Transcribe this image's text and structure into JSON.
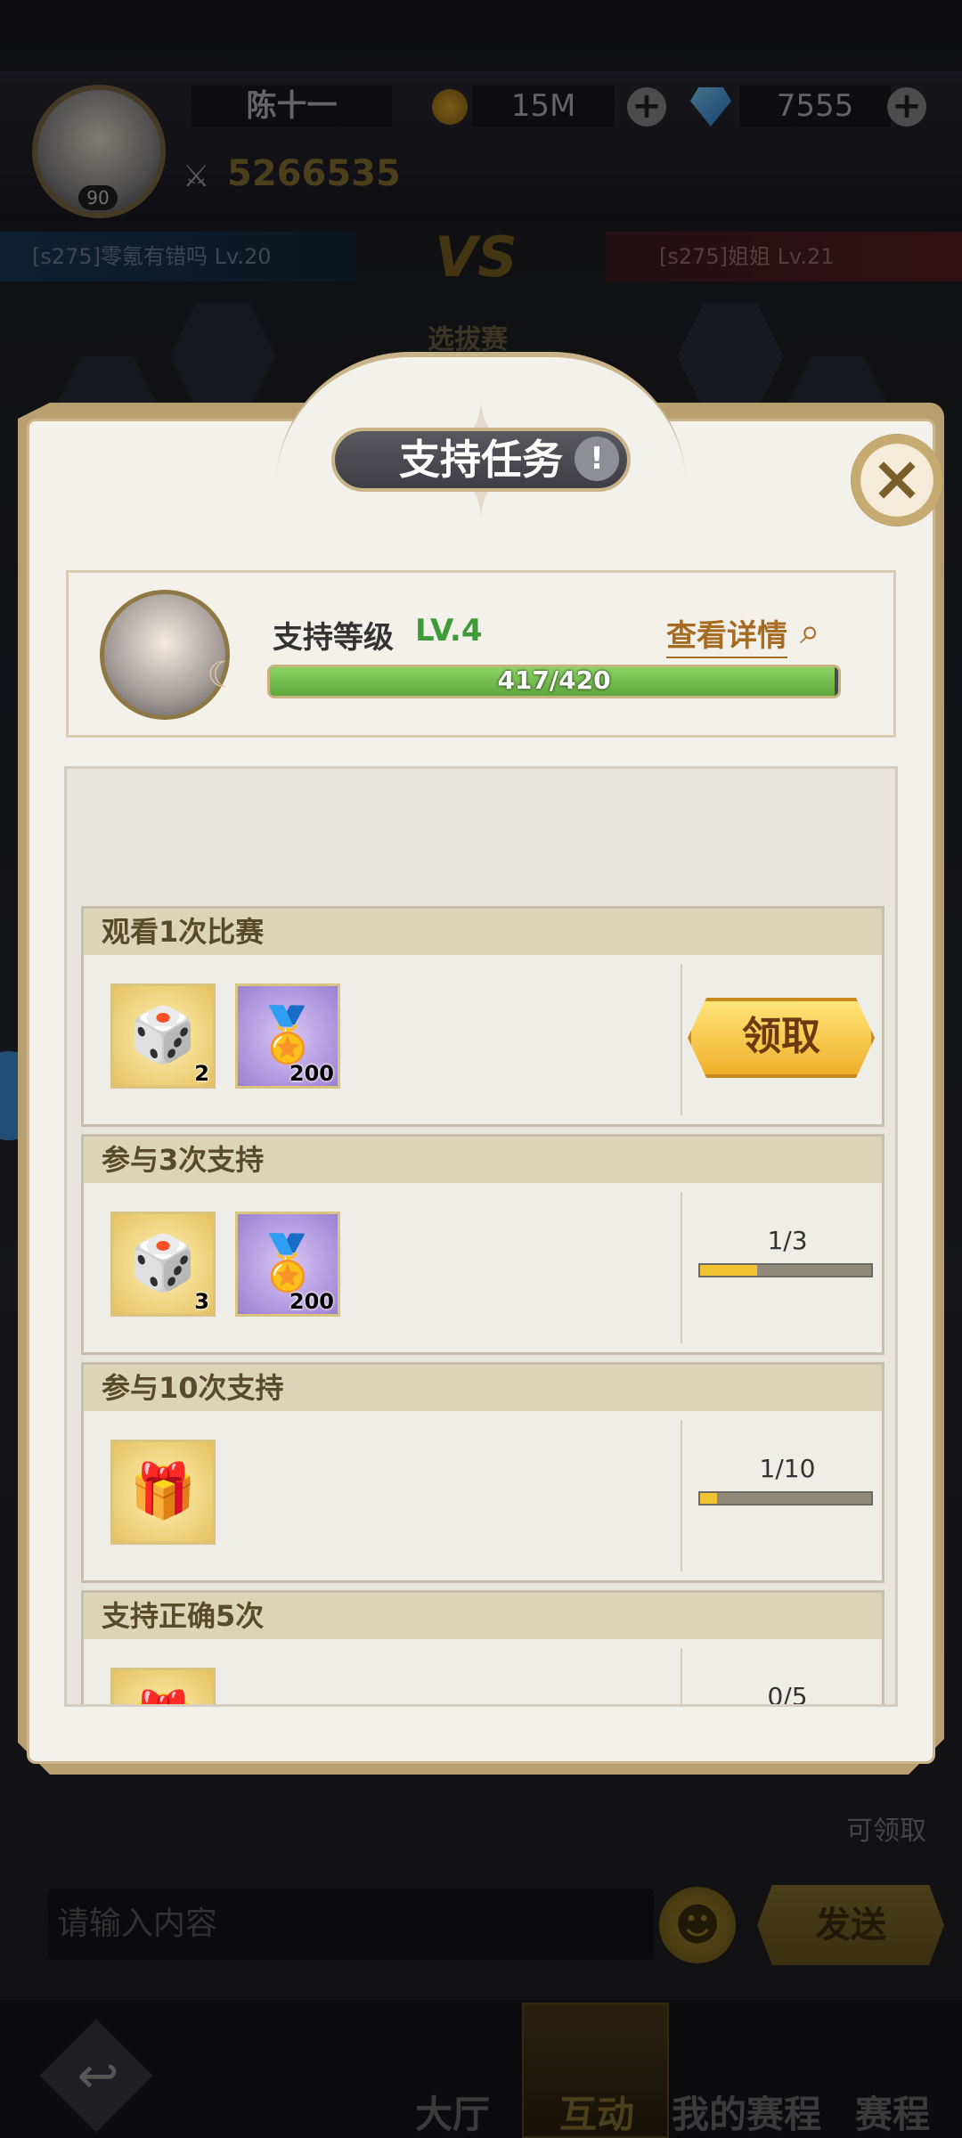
{
  "background": {
    "player_name": "陈十一",
    "avatar_level": "90",
    "gold": "15M",
    "gems": "7555",
    "power": "5266535",
    "left_team": "[s275]零氪有错吗 Lv.20",
    "right_team": "[s275]姐姐 Lv.21",
    "vs": "VS",
    "stage": "选拔赛",
    "claimable_label": "可领取",
    "chat_placeholder": "请输入内容",
    "send_label": "发送",
    "nav": [
      {
        "label": "大厅"
      },
      {
        "label": "互动"
      },
      {
        "label": "我的赛程"
      },
      {
        "label": "赛程"
      }
    ]
  },
  "modal": {
    "title": "支持任务",
    "info_icon": "!",
    "close_icon": "×",
    "support": {
      "label": "支持等级",
      "level": "LV.4",
      "details_link": "查看详情",
      "xp_text": "417/420",
      "xp_fraction": 0.993
    },
    "tasks": [
      {
        "title": "观看1次比赛",
        "rewards": [
          {
            "icon": "dice-icon",
            "count": "2",
            "style": "gold"
          },
          {
            "icon": "medal-icon",
            "count": "200",
            "style": "purple"
          }
        ],
        "status": "claim",
        "claim_label": "领取"
      },
      {
        "title": "参与3次支持",
        "rewards": [
          {
            "icon": "dice-icon",
            "count": "3",
            "style": "gold"
          },
          {
            "icon": "medal-icon",
            "count": "200",
            "style": "purple"
          }
        ],
        "status": "progress",
        "progress_text": "1/3",
        "progress_fraction": 0.333
      },
      {
        "title": "参与10次支持",
        "rewards": [
          {
            "icon": "gift-icon",
            "count": "",
            "style": "gold"
          }
        ],
        "status": "progress",
        "progress_text": "1/10",
        "progress_fraction": 0.1
      },
      {
        "title": "支持正确5次",
        "rewards": [
          {
            "icon": "gift-icon",
            "count": "",
            "style": "gold"
          }
        ],
        "status": "progress",
        "progress_text": "0/5",
        "progress_fraction": 0
      }
    ]
  }
}
